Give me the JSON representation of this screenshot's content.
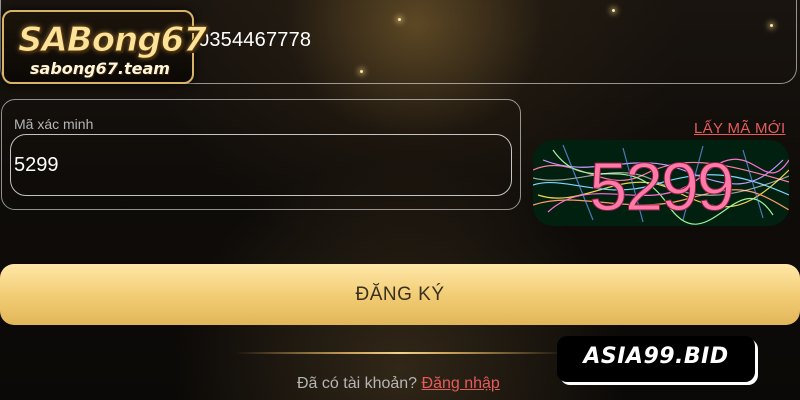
{
  "logo": {
    "brand": "SABong67",
    "domain": "sabong67.team"
  },
  "phone_field": {
    "value": "0354467778"
  },
  "captcha": {
    "label": "Mã xác minh",
    "value": "5299",
    "refresh_label": "LẤY MÃ MỚI",
    "image_text": "5299"
  },
  "register_button": {
    "label": "ĐĂNG KÝ"
  },
  "footer": {
    "prompt": "Đã có tài khoản?",
    "login_label": "Đăng nhập"
  },
  "watermark": {
    "text": "ASIA99.BID"
  },
  "colors": {
    "accent_gold": "#f1cb72",
    "link_red": "#e65c5c",
    "background": "#0f0c09"
  }
}
